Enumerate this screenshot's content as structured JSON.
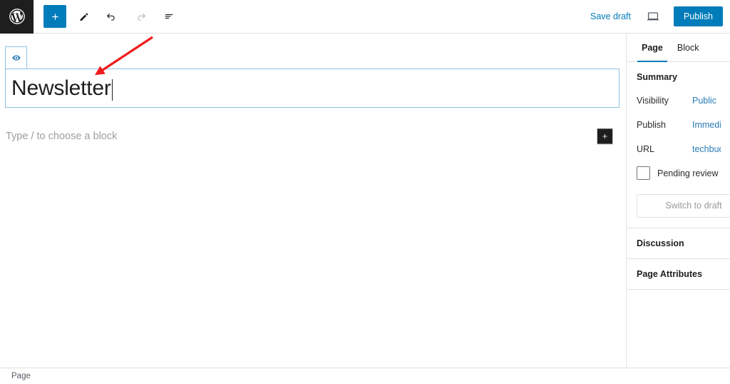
{
  "app": {
    "logo_icon": "wordpress-logo-icon"
  },
  "toolbar": {
    "add_block_icon": "plus-icon",
    "tools_icon": "pencil-icon",
    "undo_icon": "undo-arrow-icon",
    "redo_icon": "redo-arrow-icon",
    "list_view_icon": "list-view-icon",
    "save_draft_label": "Save draft",
    "preview_icon": "desktop-preview-icon",
    "publish_label": "Publish",
    "publish_color": "#007cba",
    "link_color": "#007cba"
  },
  "editor": {
    "block_tab_icon": "eye-icon",
    "title_value": "Newsletter",
    "paragraph_placeholder": "Type / to choose a block",
    "inserter_icon": "plus-icon",
    "block_border_color": "#8ec1e5"
  },
  "sidebar": {
    "tabs": [
      {
        "label": "Page",
        "active": true
      },
      {
        "label": "Block",
        "active": false
      }
    ],
    "summary": {
      "title": "Summary",
      "rows": [
        {
          "label": "Visibility",
          "value": "Public"
        },
        {
          "label": "Publish",
          "value": "Immediately"
        },
        {
          "label": "URL",
          "value": "techbuddy."
        }
      ],
      "pending_review_label": "Pending review",
      "pending_review_checked": false,
      "switch_to_draft_label": "Switch to draft"
    },
    "panels": [
      {
        "label": "Discussion"
      },
      {
        "label": "Page Attributes"
      }
    ]
  },
  "statusbar": {
    "breadcrumb": "Page"
  },
  "annotation": {
    "arrow_color": "#ee1c1c",
    "arrow_name": "red-pointer-arrow"
  }
}
